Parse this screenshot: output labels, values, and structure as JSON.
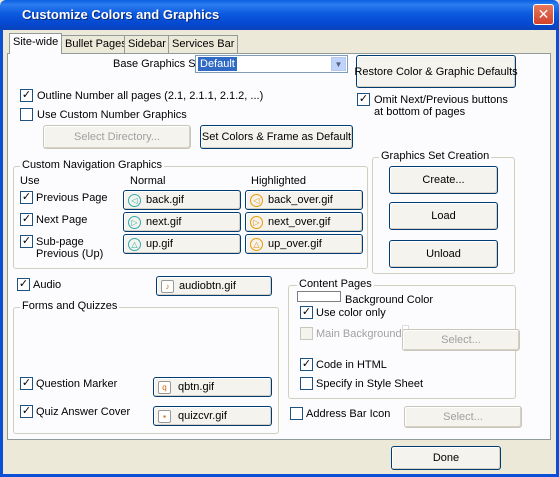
{
  "window": {
    "title": "Customize Colors and Graphics",
    "close_glyph": "✕"
  },
  "tabs": [
    {
      "label": "Site-wide",
      "active": true
    },
    {
      "label": "Bullet Pages",
      "active": false
    },
    {
      "label": "Sidebar",
      "active": false
    },
    {
      "label": "Services Bar",
      "active": false
    }
  ],
  "base_graphics": {
    "label": "Base Graphics Set",
    "value": "Default"
  },
  "restore_button": "Restore Color & Graphic Defaults",
  "outline_number": {
    "label": "Outline Number all pages (2.1, 2.1.1, 2.1.2, ...)",
    "checked": true
  },
  "custom_number": {
    "label": "Use Custom Number Graphics",
    "checked": false
  },
  "omit_nav": {
    "label": "Omit Next/Previous buttons at bottom of pages",
    "checked": true
  },
  "select_directory_button": "Select Directory...",
  "set_colors_button": "Set Colors & Frame as Default",
  "nav_graphics": {
    "group_label": "Custom Navigation Graphics",
    "col_use": "Use",
    "col_normal": "Normal",
    "col_highlighted": "Highlighted",
    "rows": [
      {
        "label": "Previous Page",
        "checked": true,
        "normal": "back.gif",
        "highlighted": "back_over.gif",
        "icon": "◁"
      },
      {
        "label": "Next Page",
        "checked": true,
        "normal": "next.gif",
        "highlighted": "next_over.gif",
        "icon": "▷"
      },
      {
        "label": "Sub-page Previous (Up)",
        "checked": true,
        "normal": "up.gif",
        "highlighted": "up_over.gif",
        "icon": "△"
      }
    ]
  },
  "graphics_set_creation": {
    "group_label": "Graphics Set Creation",
    "create": "Create...",
    "load": "Load",
    "unload": "Unload"
  },
  "audio": {
    "label": "Audio",
    "checked": true,
    "file": "audiobtn.gif"
  },
  "forms_quizzes": {
    "group_label": "Forms and Quizzes",
    "question_marker": {
      "label": "Question Marker",
      "checked": true,
      "file": "qbtn.gif"
    },
    "quiz_answer": {
      "label": "Quiz Answer Cover",
      "checked": true,
      "file": "quizcvr.gif"
    }
  },
  "content_pages": {
    "group_label": "Content Pages",
    "background_color": "Background Color",
    "use_color_only": {
      "label": "Use color only",
      "checked": true
    },
    "main_background": {
      "label": "Main Background",
      "checked": false
    },
    "select_button": "Select...",
    "code_in_html": {
      "label": "Code in HTML",
      "checked": true
    },
    "style_sheet": {
      "label": "Specify in Style Sheet",
      "checked": false
    }
  },
  "address_bar": {
    "label": "Address Bar Icon",
    "checked": false,
    "select_button": "Select..."
  },
  "done_button": "Done",
  "check_glyph": "✓",
  "colors": {
    "titlebar": "#0a5fe3",
    "dialog_bg": "#ece9d8",
    "selection": "#316ac5",
    "icon_teal": "#2a9",
    "icon_orange": "#e80"
  }
}
